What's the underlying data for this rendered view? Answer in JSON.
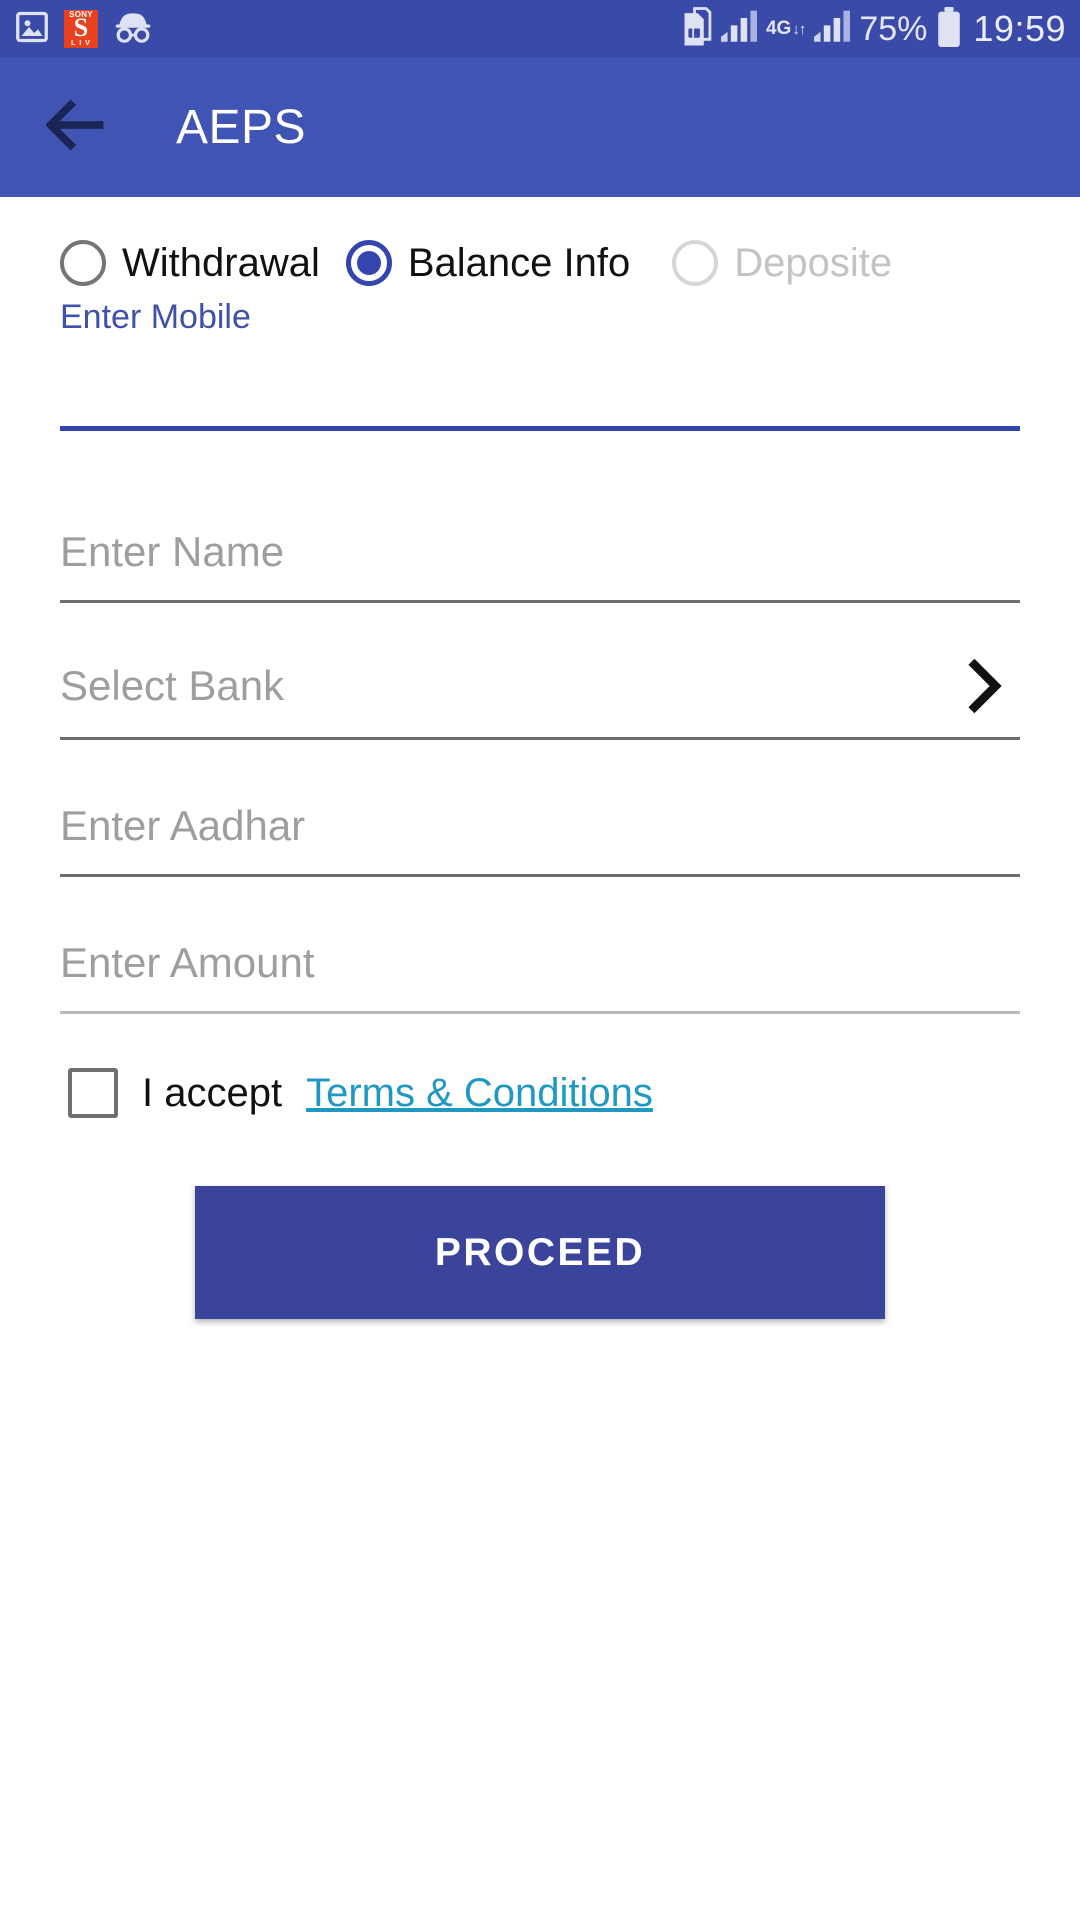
{
  "status_bar": {
    "background": "#3a4aa8",
    "left_icons": [
      {
        "name": "photo-image-icon",
        "label": "image"
      },
      {
        "name": "sonyliv-app-icon",
        "top": "SONY",
        "mid": "S",
        "bottom": "L I V"
      },
      {
        "name": "incognito-icon",
        "label": "incognito"
      }
    ],
    "right_items": {
      "sim_icon": "dual-sim-icon",
      "signal_one": "signal-bars-icon",
      "network_type": "4G",
      "network_arrows": "↓↑",
      "signal_two": "signal-bars-icon",
      "battery_percent": "75%",
      "battery_icon": "battery-icon",
      "clock": "19:59"
    }
  },
  "app_bar": {
    "background": "#4054b4",
    "back_icon": "back-arrow-icon",
    "title": "AEPS"
  },
  "transaction_types": {
    "options": [
      {
        "label": "Withdrawal",
        "selected": false,
        "disabled": false
      },
      {
        "label": "Balance Info",
        "selected": true,
        "disabled": false
      },
      {
        "label": "Deposite",
        "selected": false,
        "disabled": true
      }
    ],
    "selected_color": "#3445ad",
    "disabled_color": "#c3c3c3"
  },
  "form": {
    "mobile": {
      "label": "Enter Mobile",
      "value": "",
      "placeholder": "Enter Mobile",
      "focused": true,
      "accent": "#3445ad"
    },
    "name": {
      "placeholder": "Enter Name",
      "value": ""
    },
    "bank": {
      "placeholder": "Select Bank",
      "value": "",
      "chevron_icon": "chevron-right-icon"
    },
    "aadhar": {
      "placeholder": "Enter Aadhar",
      "value": ""
    },
    "amount": {
      "placeholder": "Enter Amount",
      "value": ""
    }
  },
  "terms": {
    "checked": false,
    "accept_text": "I accept",
    "link_text": "Terms & Conditions",
    "link_color": "#2098c4"
  },
  "actions": {
    "proceed_label": "PROCEED",
    "proceed_color": "#3a449b"
  }
}
